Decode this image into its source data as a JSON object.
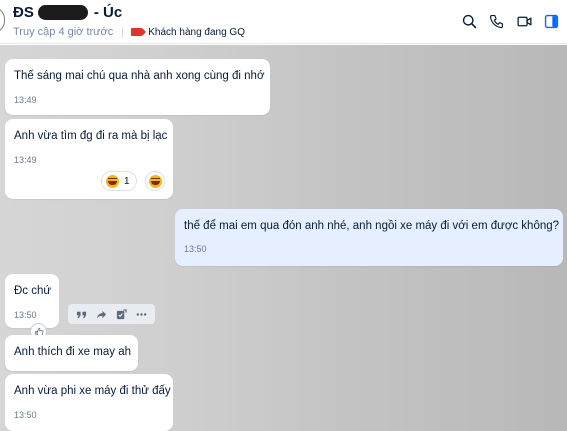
{
  "header": {
    "name_prefix": "ĐS",
    "name_suffix": "- Úc",
    "last_seen": "Truy cập 4 giờ trước",
    "tag_label": "Khách hàng đang GQ",
    "icons": [
      "search-icon",
      "phone-icon",
      "video-camera-icon",
      "sidebar-toggle-icon"
    ],
    "accent_color": "#0068ff"
  },
  "messages": [
    {
      "text": "Thế sáng mai chú qua nhà anh xong cùng đi nhớ",
      "time": "13:49"
    },
    {
      "text": "Anh vừa tìm đg đi ra mà bị lạc",
      "time": "13:49",
      "reaction_count": "1"
    },
    {
      "text": "thế để mai em qua đón anh nhé, anh ngồi xe máy đi với em được không?",
      "time": "13:50"
    },
    {
      "text": "Đc chứ",
      "time": "13:50"
    },
    {
      "text": "Anh thích đi xe may ah"
    },
    {
      "text": "Anh vừa phi xe máy đi thử đấy",
      "time": "13:50"
    }
  ],
  "message_actions": [
    "quote-icon",
    "forward-icon",
    "task-icon",
    "more-icon"
  ]
}
